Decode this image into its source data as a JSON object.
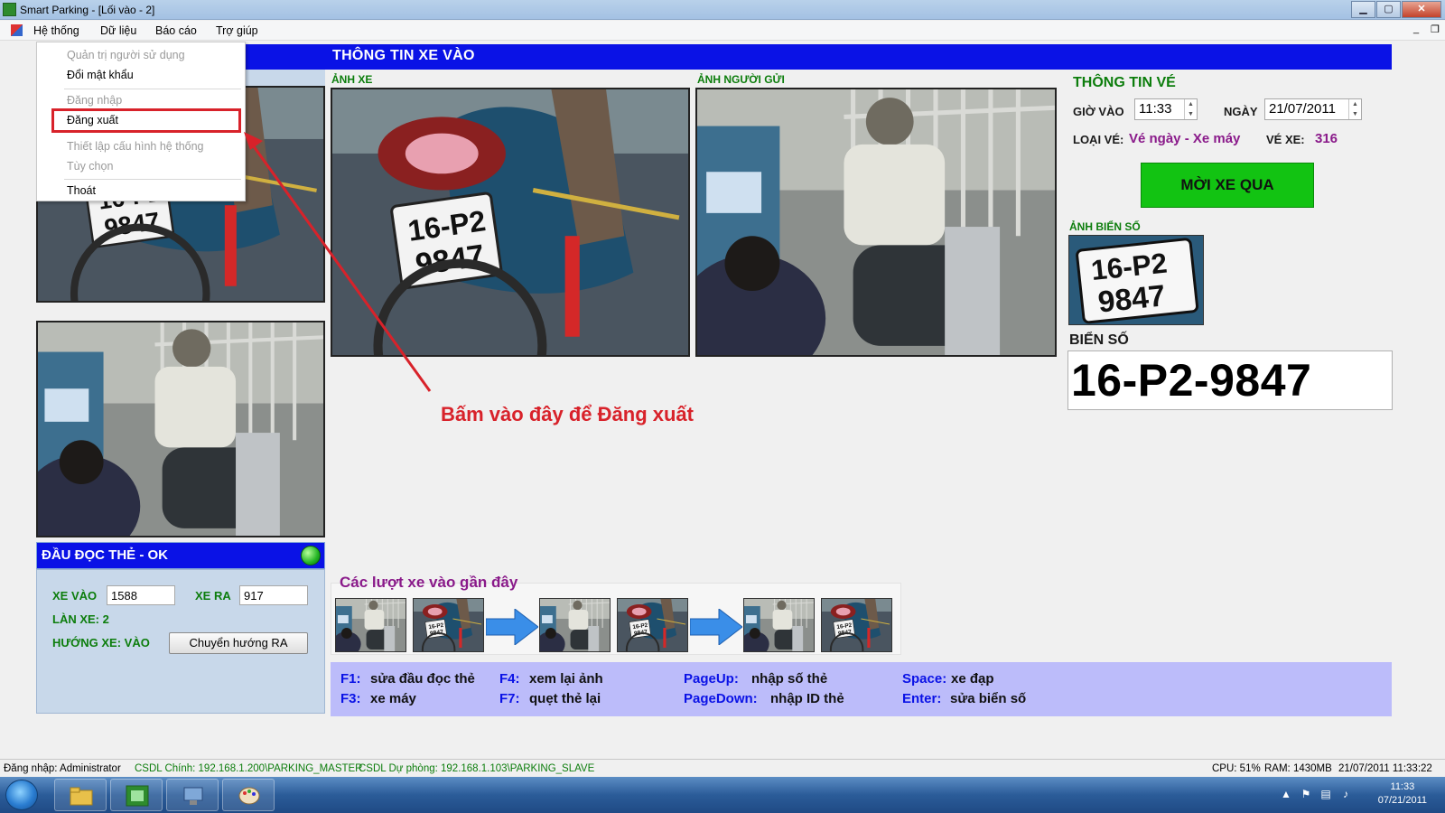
{
  "window": {
    "title": "Smart Parking - [Lối vào - 2]",
    "min_glyph": "▁",
    "max_glyph": "▢",
    "close_glyph": "✕"
  },
  "menu": {
    "items": [
      "Hệ thống",
      "Dữ liệu",
      "Báo cáo",
      "Trợ giúp"
    ],
    "mdi_min": "_",
    "mdi_restore": "❐"
  },
  "system_menu": {
    "items": [
      {
        "label": "Quản trị người sử dụng",
        "enabled": false
      },
      {
        "label": "Đổi mật khẩu",
        "enabled": true
      },
      {
        "label": "Đăng nhập",
        "enabled": false
      },
      {
        "label": "Đăng xuất",
        "enabled": true,
        "highlighted": true
      },
      {
        "label": "Thiết lập cấu hình hệ thống",
        "enabled": false
      },
      {
        "label": "Tùy chọn",
        "enabled": false
      },
      {
        "label": "Thoát",
        "enabled": true
      }
    ]
  },
  "main": {
    "title": "THÔNG TIN XE VÀO",
    "vehicle_photo_label": "ẢNH XE",
    "sender_photo_label": "ẢNH NGƯỜI GỬI"
  },
  "ticket": {
    "title": "THÔNG TIN VÉ",
    "time_label": "GIỜ VÀO",
    "time_value": "11:33",
    "date_label": "NGÀY",
    "date_value": "21/07/2011",
    "type_label": "LOẠI VÉ:",
    "type_value": "Vé ngày - Xe máy",
    "number_label": "VÉ XE:",
    "number_value": "316",
    "go_button": "MỜI XE QUA",
    "plate_photo_label": "ẢNH BIỂN SỐ",
    "plate_label": "BIỂN SỐ",
    "plate_value": "16-P2-9847"
  },
  "plate_in_photo": {
    "line1": "16-P2",
    "line2": "9847"
  },
  "annotation": "Bấm vào đây để Đăng xuất",
  "reader": {
    "title": "ĐẦU ĐỌC THẺ - OK",
    "status_color": "#22b422",
    "in_label": "XE VÀO",
    "in_value": "1588",
    "out_label": "XE RA",
    "out_value": "917",
    "lane": "LÀN XE: 2",
    "direction": "HƯỚNG XE: VÀO",
    "switch_button": "Chuyển hướng RA"
  },
  "recent": {
    "title": "Các lượt xe vào gần đây"
  },
  "shortcuts": [
    {
      "key": "F1:",
      "desc": "sửa đầu đọc thẻ"
    },
    {
      "key": "F3:",
      "desc": "xe máy"
    },
    {
      "key": "F4:",
      "desc": "xem lại ảnh"
    },
    {
      "key": "F7:",
      "desc": "quẹt thẻ lại"
    },
    {
      "key": "PageUp:",
      "desc": "nhập số thẻ"
    },
    {
      "key": "PageDown:",
      "desc": "nhập ID thẻ"
    },
    {
      "key": "Space:",
      "desc": "xe đạp"
    },
    {
      "key": "Enter:",
      "desc": "sửa biển số"
    }
  ],
  "status": {
    "login": "Đăng nhập: Administrator",
    "db_main": "CSDL Chính: 192.168.1.200\\PARKING_MASTER",
    "db_backup": "CSDL Dự phòng: 192.168.1.103\\PARKING_SLAVE",
    "cpu": "CPU: 51%",
    "ram": "RAM: 1430MB",
    "datetime": "21/07/2011 11:33:22"
  },
  "taskbar": {
    "clock_time": "11:33",
    "clock_date": "07/21/2011"
  },
  "colors": {
    "header_blue": "#0a12e6",
    "label_green": "#0c7d0c",
    "accent_purple": "#8a1a8a",
    "go_green": "#12c312",
    "annotation_red": "#d8222a"
  }
}
